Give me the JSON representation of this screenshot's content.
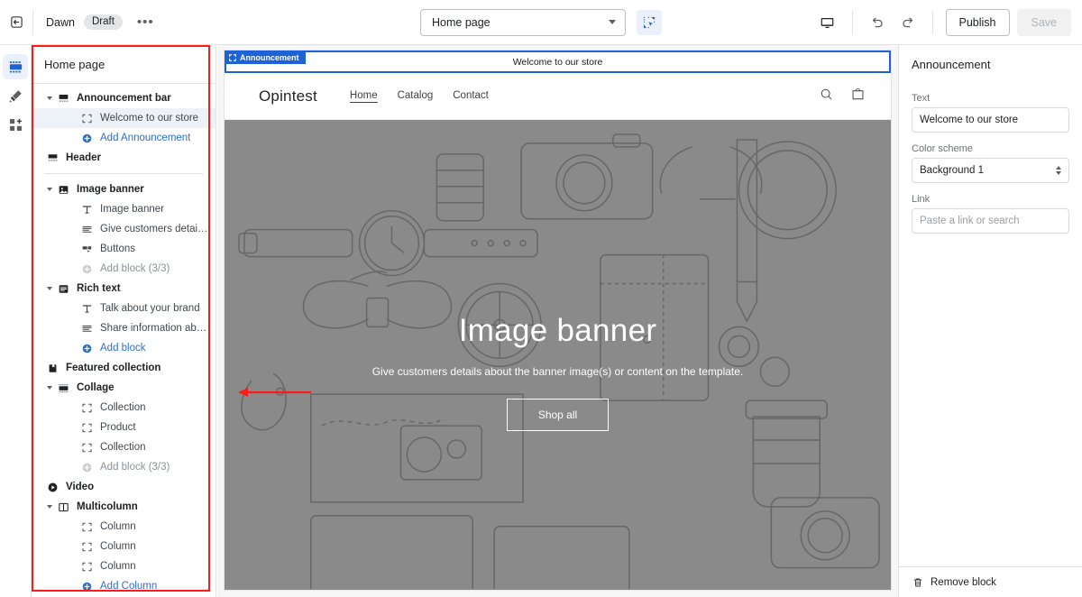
{
  "topbar": {
    "exit_icon": "exit-arrow-icon",
    "theme_name": "Dawn",
    "status_badge": "Draft",
    "more_label": "•••",
    "page_selector_value": "Home page",
    "inspect_icon": "inspector-select-icon",
    "device_icon": "desktop-monitor-icon",
    "undo_icon": "undo-arrow-icon",
    "redo_icon": "redo-arrow-icon",
    "publish_label": "Publish",
    "save_label": "Save"
  },
  "rail": {
    "items": [
      {
        "name": "sections-icon",
        "active": true
      },
      {
        "name": "theme-settings-brush-icon",
        "active": false
      },
      {
        "name": "apps-blocks-icon",
        "active": false
      }
    ]
  },
  "sidebar": {
    "title": "Home page",
    "rows": [
      {
        "label": "Announcement bar",
        "level": "section",
        "icon": "announcement-bar-icon",
        "caret": true
      },
      {
        "label": "Welcome to our store",
        "level": "block",
        "icon": "block-brackets-icon",
        "selected": true
      },
      {
        "label": "Add Announcement",
        "level": "add",
        "icon": "circle-plus-icon"
      },
      {
        "label": "Header",
        "level": "section",
        "icon": "header-icon",
        "caret": false
      },
      {
        "divider": true
      },
      {
        "label": "Image banner",
        "level": "section",
        "icon": "image-icon",
        "caret": true
      },
      {
        "label": "Image banner",
        "level": "block",
        "icon": "text-heading-icon"
      },
      {
        "label": "Give customers details abou…",
        "level": "block",
        "icon": "paragraph-lines-icon"
      },
      {
        "label": "Buttons",
        "level": "block",
        "icon": "buttons-icon"
      },
      {
        "label": "Add block (3/3)",
        "level": "add",
        "icon": "circle-plus-icon",
        "disabled": true
      },
      {
        "label": "Rich text",
        "level": "section",
        "icon": "rich-text-icon",
        "caret": true
      },
      {
        "label": "Talk about your brand",
        "level": "block",
        "icon": "text-heading-icon"
      },
      {
        "label": "Share information about you…",
        "level": "block",
        "icon": "paragraph-lines-icon"
      },
      {
        "label": "Add block",
        "level": "add",
        "icon": "circle-plus-icon"
      },
      {
        "label": "Featured collection",
        "level": "section",
        "icon": "collection-icon",
        "caret": false
      },
      {
        "label": "Collage",
        "level": "section",
        "icon": "collage-icon",
        "caret": true
      },
      {
        "label": "Collection",
        "level": "block",
        "icon": "block-brackets-icon"
      },
      {
        "label": "Product",
        "level": "block",
        "icon": "block-brackets-icon"
      },
      {
        "label": "Collection",
        "level": "block",
        "icon": "block-brackets-icon"
      },
      {
        "label": "Add block (3/3)",
        "level": "add",
        "icon": "circle-plus-icon",
        "disabled": true
      },
      {
        "label": "Video",
        "level": "section",
        "icon": "video-play-icon",
        "caret": false
      },
      {
        "label": "Multicolumn",
        "level": "section",
        "icon": "multicolumn-icon",
        "caret": true
      },
      {
        "label": "Column",
        "level": "block",
        "icon": "block-brackets-icon"
      },
      {
        "label": "Column",
        "level": "block",
        "icon": "block-brackets-icon"
      },
      {
        "label": "Column",
        "level": "block",
        "icon": "block-brackets-icon"
      },
      {
        "label": "Add Column",
        "level": "add",
        "icon": "circle-plus-icon"
      }
    ]
  },
  "preview": {
    "announcement": {
      "tag_label": "Announcement",
      "text": "Welcome to our store"
    },
    "store": {
      "logo": "Opintest",
      "nav": [
        {
          "label": "Home",
          "active": true
        },
        {
          "label": "Catalog",
          "active": false
        },
        {
          "label": "Contact",
          "active": false
        }
      ],
      "search_icon": "search-icon",
      "cart_icon": "shopping-bag-icon"
    },
    "hero": {
      "title": "Image banner",
      "subtitle": "Give customers details about the banner image(s) or content on the template.",
      "button_label": "Shop all"
    }
  },
  "rightpanel": {
    "title": "Announcement",
    "text_label": "Text",
    "text_value": "Welcome to our store",
    "color_scheme_label": "Color scheme",
    "color_scheme_value": "Background 1",
    "link_label": "Link",
    "link_value": "",
    "link_placeholder": "Paste a link or search",
    "remove_label": "Remove block",
    "trash_icon": "trash-icon"
  },
  "annotation": {
    "box_color": "#ff1a1a",
    "arrow_color": "#ff1a1a"
  }
}
